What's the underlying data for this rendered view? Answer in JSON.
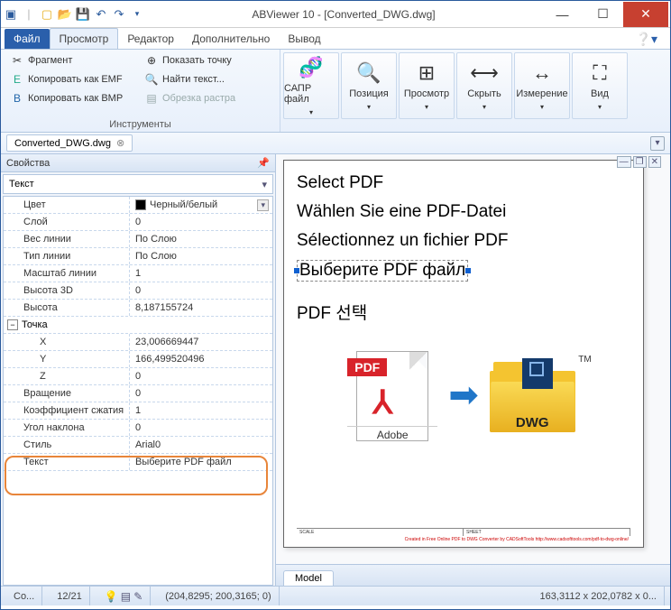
{
  "title": "ABViewer 10 - [Converted_DWG.dwg]",
  "tabs": {
    "file": "Файл",
    "view": "Просмотр",
    "editor": "Редактор",
    "extra": "Дополнительно",
    "output": "Вывод"
  },
  "ribbon": {
    "group1_label": "Инструменты",
    "fragment": "Фрагмент",
    "copy_emf": "Копировать как EMF",
    "copy_bmp": "Копировать как BMP",
    "show_point": "Показать точку",
    "find_text": "Найти текст...",
    "clip_raster": "Обрезка растра",
    "big": {
      "cad": "САПР файл",
      "pos": "Позиция",
      "view": "Просмотр",
      "hide": "Скрыть",
      "measure": "Измерение",
      "vid": "Вид"
    }
  },
  "doc_tab": "Converted_DWG.dwg",
  "panel_title": "Свойства",
  "dropdown": "Текст",
  "props": [
    {
      "name": "Цвет",
      "val": "Черный/белый",
      "swatch": true,
      "dd": true
    },
    {
      "name": "Слой",
      "val": "0"
    },
    {
      "name": "Вес линии",
      "val": "По Слою"
    },
    {
      "name": "Тип линии",
      "val": "По Слою"
    },
    {
      "name": "Масштаб линии",
      "val": "1"
    },
    {
      "name": "Высота 3D",
      "val": "0"
    },
    {
      "name": "Высота",
      "val": "8,187155724"
    }
  ],
  "group_point": "Точка",
  "props2": [
    {
      "name": "X",
      "val": "23,006669447",
      "sub": true
    },
    {
      "name": "Y",
      "val": "166,499520496",
      "sub": true
    },
    {
      "name": "Z",
      "val": "0",
      "sub": true
    },
    {
      "name": "Вращение",
      "val": "0"
    },
    {
      "name": "Коэффициент сжатия",
      "val": "1"
    },
    {
      "name": "Угол наклона",
      "val": "0"
    },
    {
      "name": "Стиль",
      "val": "Arial0"
    },
    {
      "name": "Текст",
      "val": "Выберите PDF файл"
    }
  ],
  "canvas": {
    "l1": "Select PDF",
    "l2": "Wählen Sie eine PDF-Datei",
    "l3": "Sélectionnez un fichier PDF",
    "l4": "Выберите PDF файл",
    "l5": "PDF 선택",
    "pdf": "PDF",
    "adobe": "Adobe",
    "dwg": "DWG",
    "tm": "TM",
    "frame_left": "SCALE",
    "frame_right": "SHEET",
    "red": "Created in Free Online PDF to DWG Converter by CADSoftTools http://www.cadsofttools.com/pdf-to-dwg-online/"
  },
  "model_tab": "Model",
  "status": {
    "s1": "Co...",
    "s2": "12/21",
    "coords": "(204,8295; 200,3165; 0)",
    "size": "163,3112 x 202,0782 x 0..."
  }
}
